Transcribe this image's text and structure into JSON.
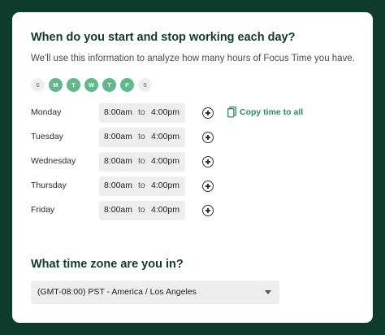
{
  "heading": "When do you start and stop working each day?",
  "subtext": "We'll use this information to analyze how many hours of Focus Time you have.",
  "days": [
    {
      "letter": "S",
      "selected": false
    },
    {
      "letter": "M",
      "selected": true
    },
    {
      "letter": "T",
      "selected": true
    },
    {
      "letter": "W",
      "selected": true
    },
    {
      "letter": "T",
      "selected": true
    },
    {
      "letter": "F",
      "selected": true
    },
    {
      "letter": "S",
      "selected": false
    }
  ],
  "schedule": [
    {
      "day": "Monday",
      "start": "8:00am",
      "sep": "to",
      "end": "4:00pm"
    },
    {
      "day": "Tuesday",
      "start": "8:00am",
      "sep": "to",
      "end": "4:00pm"
    },
    {
      "day": "Wednesday",
      "start": "8:00am",
      "sep": "to",
      "end": "4:00pm"
    },
    {
      "day": "Thursday",
      "start": "8:00am",
      "sep": "to",
      "end": "4:00pm"
    },
    {
      "day": "Friday",
      "start": "8:00am",
      "sep": "to",
      "end": "4:00pm"
    }
  ],
  "copy_action": {
    "label": "Copy time to all",
    "icon": "copy-icon"
  },
  "timezone": {
    "heading": "What time zone are you in?",
    "selected": "(GMT-08:00) PST - America / Los Angeles"
  },
  "colors": {
    "background": "#0f3b2c",
    "heading": "#0f3b2c",
    "accent": "#5fb98b",
    "link": "#2f8a5c"
  }
}
